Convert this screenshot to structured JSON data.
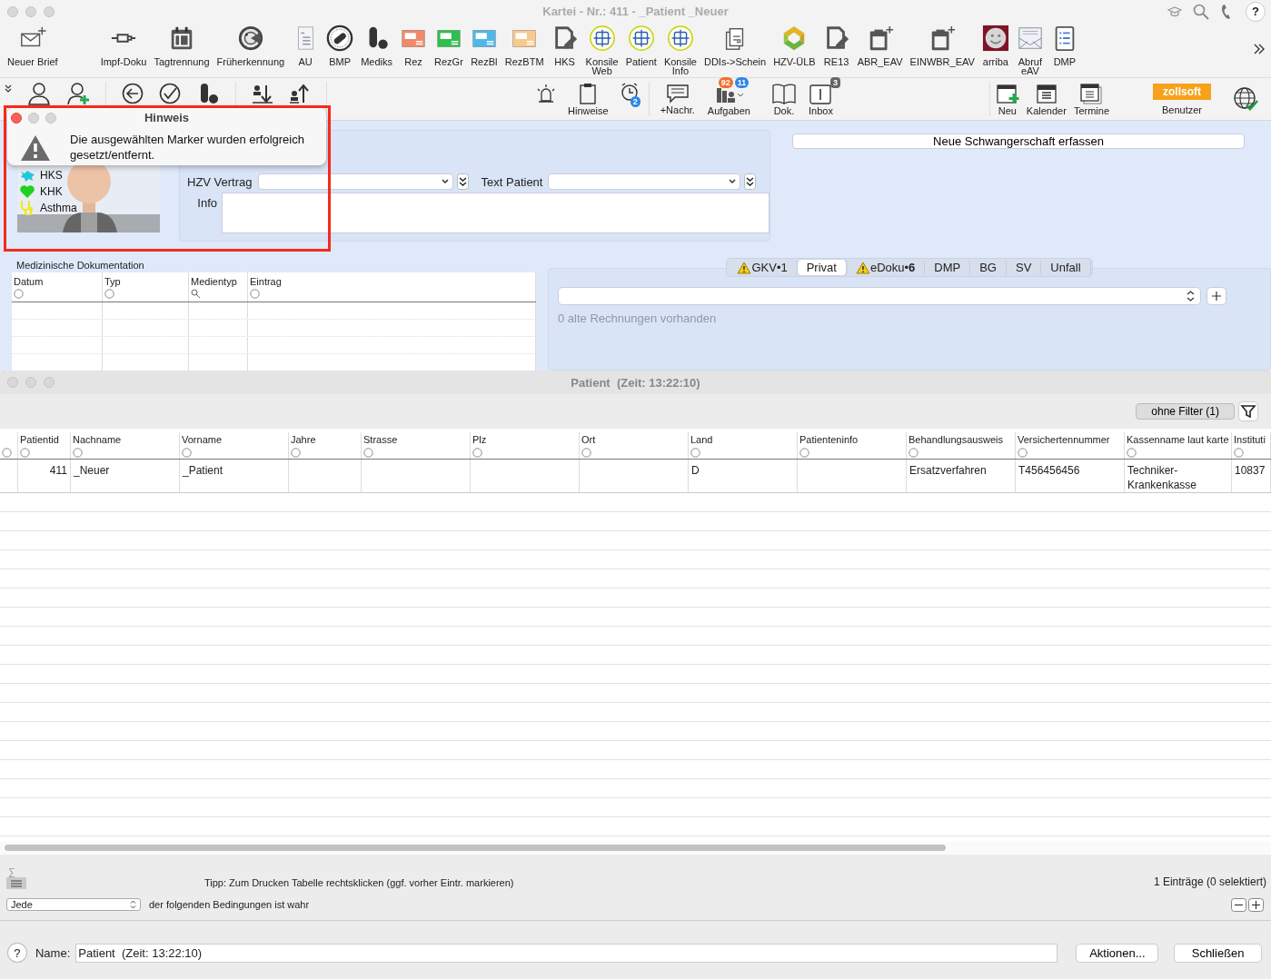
{
  "window": {
    "title": "Kartei - Nr.: 411 - _Patient _Neuer",
    "help": "?"
  },
  "toolbar": [
    {
      "label": "Neuer Brief",
      "kind": "letter"
    },
    {
      "label": "Impf-Doku",
      "kind": "syringe"
    },
    {
      "label": "Tagtrennung",
      "kind": "calendar"
    },
    {
      "label": "Früherkennung",
      "kind": "radar"
    },
    {
      "label": "AU",
      "kind": "doc"
    },
    {
      "label": "BMP",
      "kind": "disc"
    },
    {
      "label": "Mediks",
      "kind": "pill"
    },
    {
      "label": "Rez",
      "kind": "card",
      "color": "#f08a6a"
    },
    {
      "label": "RezGr",
      "kind": "card",
      "color": "#2fbf4f"
    },
    {
      "label": "RezBl",
      "kind": "card",
      "color": "#4fb8ea"
    },
    {
      "label": "RezBTM",
      "kind": "card",
      "color": "#f7c98a"
    },
    {
      "label": "HKS",
      "kind": "pendoc"
    },
    {
      "label": "Konsile\nWeb",
      "kind": "konsil"
    },
    {
      "label": "Patient",
      "kind": "konsil"
    },
    {
      "label": "Konsile\nInfo",
      "kind": "konsil"
    },
    {
      "label": "DDIs->Schein",
      "kind": "docs"
    },
    {
      "label": "HZV-ÜLB",
      "kind": "hzv"
    },
    {
      "label": "RE13",
      "kind": "pendoc"
    },
    {
      "label": "ABR_EAV",
      "kind": "clip"
    },
    {
      "label": "EINWBR_EAV",
      "kind": "clip"
    },
    {
      "label": "arriba",
      "kind": "smiley"
    },
    {
      "label": "Abruf\neAV",
      "kind": "mail"
    },
    {
      "label": "DMP",
      "kind": "list"
    }
  ],
  "notices": {
    "label": "Hinweise",
    "badge": "2"
  },
  "messages": {
    "label": "+Nachr."
  },
  "tasks": {
    "label": "Aufgaben",
    "badge_count": "92",
    "badge_new": "11"
  },
  "documents": {
    "label": "Dok."
  },
  "inbox": {
    "label": "Inbox",
    "badge": "3"
  },
  "calendar_tools": [
    {
      "label": "Neu",
      "kind": "new"
    },
    {
      "label": "Kalender",
      "kind": "calendar"
    },
    {
      "label": "Termine",
      "kind": "appointments"
    }
  ],
  "user": {
    "logo": "zollsoft",
    "label": "Benutzer"
  },
  "dialog": {
    "title": "Hinweis",
    "message": "Die ausgewählten Marker wurden erfolgreich gesetzt/entfernt."
  },
  "markers": [
    {
      "label": "HKS",
      "kind": "blob",
      "color": "#1ec8d8"
    },
    {
      "label": "KHK",
      "kind": "heart",
      "color": "#1fd21f"
    },
    {
      "label": "Asthma",
      "kind": "stethoscope",
      "color": "#f0e818"
    }
  ],
  "patient_form": {
    "contract_label": "HZV Vertrag",
    "text_label": "Text Patient",
    "info_label": "Info"
  },
  "pregnancy_button": "Neue Schwangerschaft erfassen",
  "docs": {
    "title": "Medizinische Dokumentation",
    "columns": [
      {
        "label": "Datum",
        "kind": "circle"
      },
      {
        "label": "Typ",
        "kind": "circle"
      },
      {
        "label": "Medientyp",
        "kind": "search"
      },
      {
        "label": "Eintrag",
        "kind": "circle"
      }
    ]
  },
  "billing": {
    "tabs": [
      {
        "label": "GKV•1",
        "warning": true,
        "selected": false
      },
      {
        "label": "Privat",
        "warning": false,
        "selected": true
      },
      {
        "label": "eDoku•**6**",
        "warning": true,
        "selected": false
      },
      {
        "label": "DMP",
        "warning": false,
        "selected": false
      },
      {
        "label": "BG",
        "warning": false,
        "selected": false
      },
      {
        "label": "SV",
        "warning": false,
        "selected": false
      },
      {
        "label": "Unfall",
        "warning": false,
        "selected": false
      }
    ],
    "note": "0 alte Rechnungen vorhanden"
  },
  "patient_window": {
    "title": "Patient  (Zeit: 13:22:10)",
    "filter_button": "ohne Filter (1)",
    "columns": [
      "Patientid",
      "Nachname",
      "Vorname",
      "Jahre",
      "Strasse",
      "Plz",
      "Ort",
      "Land",
      "Patienteninfo",
      "Behandlungsausweis",
      "Versichertennummer",
      "Kassenname laut karte",
      "Instituti"
    ],
    "rows": [
      {
        "cells": [
          "411",
          "_Neuer",
          "_Patient",
          null,
          null,
          null,
          null,
          "D",
          null,
          "Ersatzverfahren",
          "T456456456",
          "Techniker-Krankenkasse",
          "10837"
        ]
      }
    ],
    "sum_symbol": "∑",
    "tip": "Tipp: Zum Drucken Tabelle rechtsklicken (ggf. vorher Eintr. markieren)",
    "count": "1 Einträge (0 selektiert)",
    "match_select": "Jede",
    "match_text": "der folgenden Bedingungen ist wahr",
    "help": "?",
    "name_label": "Name:",
    "name_value": "Patient  (Zeit: 13:22:10)",
    "buttons": [
      "Aktionen...",
      "Schließen"
    ]
  }
}
